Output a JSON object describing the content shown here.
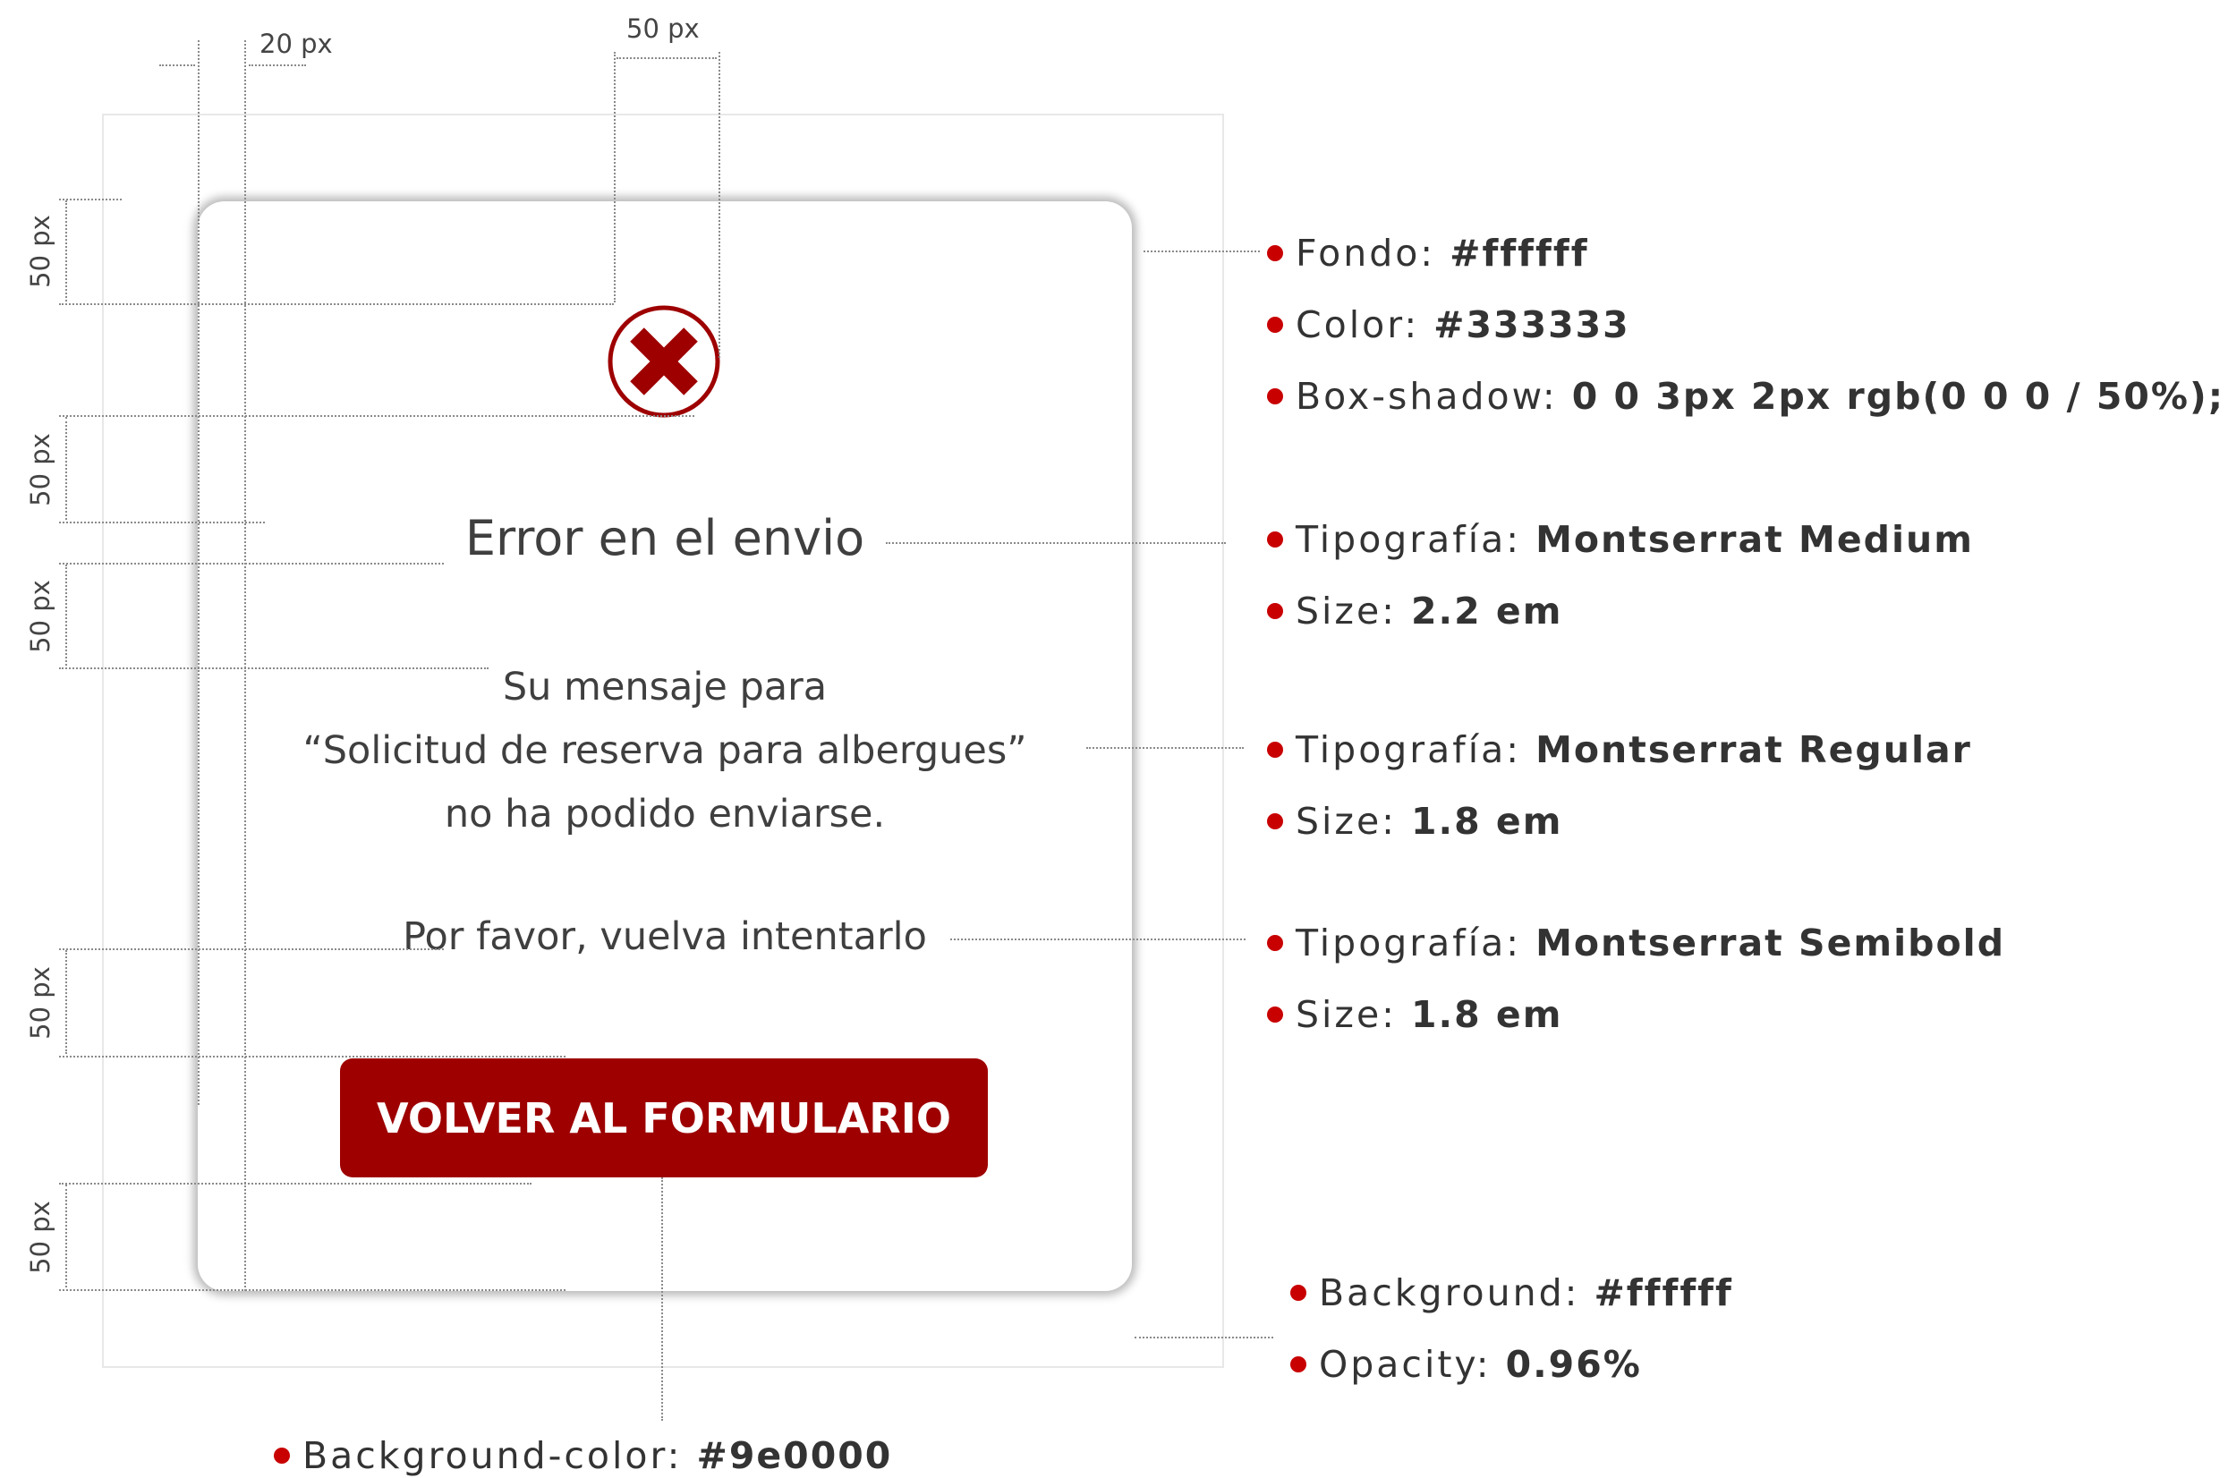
{
  "dimensions": {
    "top_left_gap": "20 px",
    "icon_width": "50 px",
    "vertical_gap_1": "50 px",
    "vertical_gap_2": "50 px",
    "vertical_gap_3": "50 px",
    "vertical_gap_4": "50 px",
    "vertical_gap_5": "50 px"
  },
  "modal": {
    "icon": "close-circle-icon",
    "title": "Error en el envio",
    "message_line1": "Su mensaje para",
    "message_line2": "“Solicitud de reserva para albergues”",
    "message_line3": "no ha podido enviarse.",
    "retry": "Por favor, vuelva intentarlo",
    "button_label": "VOLVER AL FORMULARIO",
    "accent_color": "#9e0000"
  },
  "specs": {
    "card": [
      {
        "key": "Fondo: ",
        "value": "#ffffff"
      },
      {
        "key": "Color: ",
        "value": "#333333"
      },
      {
        "key": "Box-shadow: ",
        "value": "0 0 3px 2px rgb(0 0 0 / 50%);"
      }
    ],
    "title": [
      {
        "key": "Tipografía: ",
        "value": "Montserrat Medium"
      },
      {
        "key": "Size: ",
        "value": "2.2 em"
      }
    ],
    "message": [
      {
        "key": "Tipografía: ",
        "value": "Montserrat Regular"
      },
      {
        "key": "Size: ",
        "value": "1.8 em"
      }
    ],
    "retry": [
      {
        "key": "Tipografía: ",
        "value": "Montserrat Semibold"
      },
      {
        "key": "Size: ",
        "value": "1.8 em"
      }
    ],
    "overlay": [
      {
        "key": "Background: ",
        "value": "#ffffff"
      },
      {
        "key": "Opacity: ",
        "value": "0.96%"
      }
    ],
    "button": [
      {
        "key": "Background-color: ",
        "value": "#9e0000"
      }
    ]
  }
}
